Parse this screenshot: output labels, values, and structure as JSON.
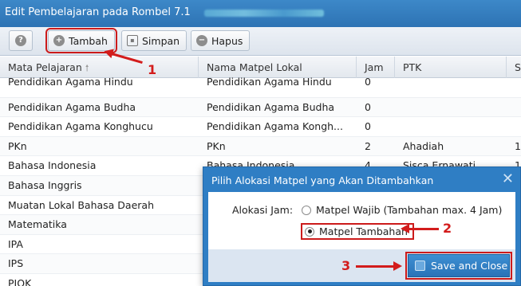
{
  "window": {
    "title": "Edit Pembelajaran pada Rombel 7.1"
  },
  "toolbar": {
    "help_icon": "?",
    "tambah_label": "Tambah",
    "simpan_label": "Simpan",
    "hapus_label": "Hapus"
  },
  "grid": {
    "columns": [
      "Mata Pelajaran",
      "Nama Matpel Lokal",
      "Jam",
      "PTK",
      "S"
    ],
    "rows": [
      {
        "mata": "Pendidikan Agama Hindu",
        "lokal": "Pendidikan Agama Hindu",
        "jam": "0",
        "ptk": "",
        "s": ""
      },
      {
        "mata": "Pendidikan Agama Budha",
        "lokal": "Pendidikan Agama Budha",
        "jam": "0",
        "ptk": "",
        "s": ""
      },
      {
        "mata": "Pendidikan Agama Konghucu",
        "lokal": "Pendidikan Agama Kongh...",
        "jam": "0",
        "ptk": "",
        "s": ""
      },
      {
        "mata": "PKn",
        "lokal": "PKn",
        "jam": "2",
        "ptk": "Ahadiah",
        "s": "1"
      },
      {
        "mata": "Bahasa Indonesia",
        "lokal": "Bahasa Indonesia",
        "jam": "4",
        "ptk": "Sisca Ernawati",
        "s": "1"
      },
      {
        "mata": "Bahasa Inggris",
        "lokal": "",
        "jam": "",
        "ptk": "",
        "s": ""
      },
      {
        "mata": "Muatan Lokal Bahasa Daerah",
        "lokal": "",
        "jam": "",
        "ptk": "",
        "s": ""
      },
      {
        "mata": "Matematika",
        "lokal": "",
        "jam": "",
        "ptk": "",
        "s": ""
      },
      {
        "mata": "IPA",
        "lokal": "",
        "jam": "",
        "ptk": "",
        "s": ""
      },
      {
        "mata": "IPS",
        "lokal": "",
        "jam": "",
        "ptk": "",
        "s": ""
      },
      {
        "mata": "PJOK",
        "lokal": "",
        "jam": "",
        "ptk": "",
        "s": ""
      }
    ]
  },
  "dialog": {
    "title": "Pilih Alokasi Matpel yang Akan Ditambahkan",
    "close_icon": "✕",
    "alokasi_label": "Alokasi Jam:",
    "option_wajib": "Matpel Wajib (Tambahan max. 4 Jam)",
    "option_tambahan": "Matpel Tambahan",
    "selected": "Matpel Tambahan",
    "save_label": "Save and Close"
  },
  "annotations": {
    "step1": "1",
    "step2": "2",
    "step3": "3",
    "color": "#d31c1c"
  }
}
